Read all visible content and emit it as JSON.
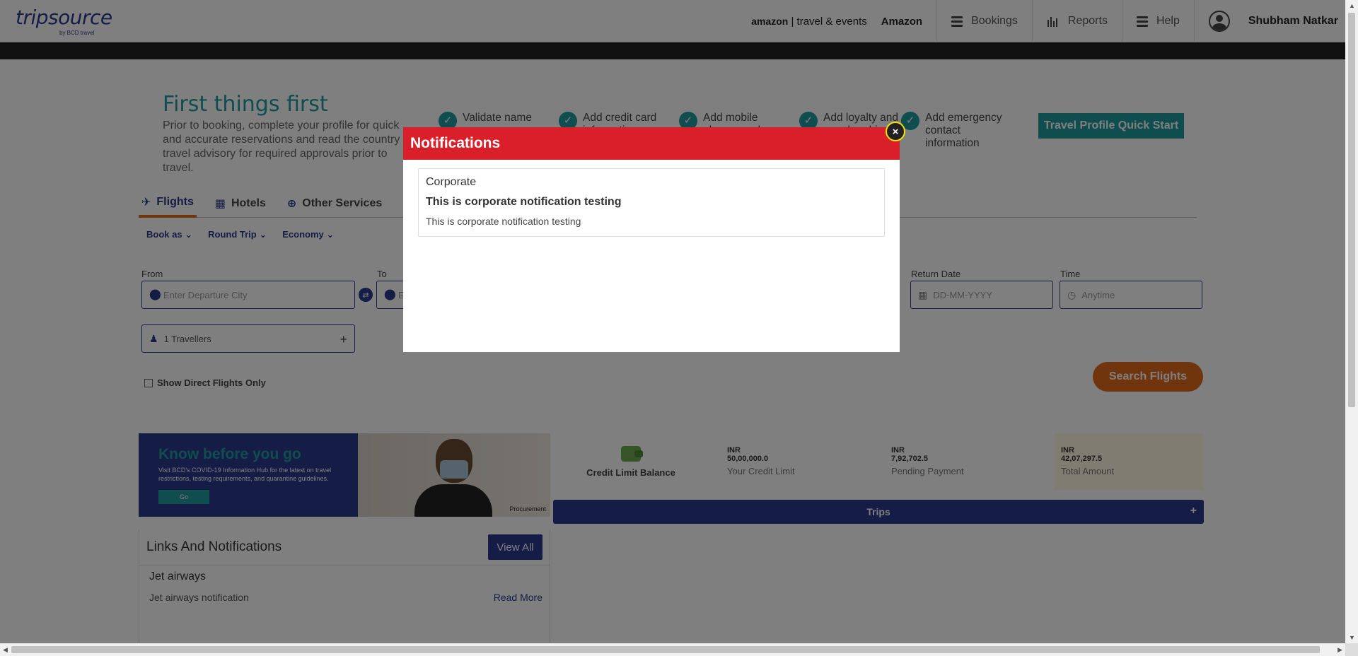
{
  "header": {
    "logo": "tripsource",
    "logo_sub": "by BCD travel",
    "partner_logo_prefix": "amazon",
    "partner_logo_suffix": "travel & events",
    "partner_name": "Amazon",
    "nav": [
      {
        "label": "Bookings",
        "icon": "menu-icon"
      },
      {
        "label": "Reports",
        "icon": "bar-chart-icon"
      },
      {
        "label": "Help",
        "icon": "menu-icon"
      }
    ],
    "user_name": "Shubham Natkar"
  },
  "first_things": {
    "title": "First things first",
    "text": "Prior to booking, complete your profile for quick and accurate reservations and read the country travel advisory for required approvals prior to travel.",
    "steps": [
      {
        "label": "Validate name"
      },
      {
        "label": "Add credit card information"
      },
      {
        "label": "Add mobile phone number"
      },
      {
        "label": "Add loyalty and membership"
      },
      {
        "label": "Add emergency contact information"
      }
    ],
    "button": "Travel Profile Quick Start"
  },
  "tabs": [
    {
      "label": "Flights",
      "icon": "plane-icon",
      "active": true
    },
    {
      "label": "Hotels",
      "icon": "building-icon",
      "active": false
    },
    {
      "label": "Other Services",
      "icon": "plus-circle-icon",
      "active": false
    }
  ],
  "options": [
    "Book as",
    "Round Trip",
    "Economy"
  ],
  "form": {
    "from_label": "From",
    "from_placeholder": "Enter Departure City",
    "to_label": "To",
    "to_placeholder": "E",
    "return_label": "Return Date",
    "return_placeholder": "DD-MM-YYYY",
    "time_label": "Time",
    "time_placeholder": "Anytime",
    "travellers": "1 Travellers",
    "direct_only": "Show Direct Flights Only",
    "search_button": "Search Flights"
  },
  "banner": {
    "title": "Know before you go",
    "text": "Visit BCD's COVID-19 Information Hub for the latest on travel restrictions, testing requirements, and quarantine guidelines.",
    "go": "Go",
    "tag": "Procurement"
  },
  "links": {
    "title": "Links And Notifications",
    "view_all": "View All",
    "item_title": "Jet airways",
    "item_text": "Jet airways notification",
    "read_more": "Read More"
  },
  "credit": {
    "label": "Credit Limit Balance",
    "currency": "INR",
    "credit_limit": "50,00,000.0",
    "credit_limit_label": "Your Credit Limit",
    "pending": "7,92,702.5",
    "pending_label": "Pending Payment",
    "total": "42,07,297.5",
    "total_label": "Total Amount"
  },
  "trips": {
    "label": "Trips",
    "expand": "+"
  },
  "modal": {
    "title": "Notifications",
    "close": "×",
    "category": "Corporate",
    "notif_title": "This is corporate notification testing",
    "notif_body": "This is corporate notification testing"
  },
  "colors": {
    "brand_blue": "#2b3a8f",
    "teal": "#1f9a9d",
    "orange": "#e06b1a",
    "modal_header": "#d9202a"
  }
}
